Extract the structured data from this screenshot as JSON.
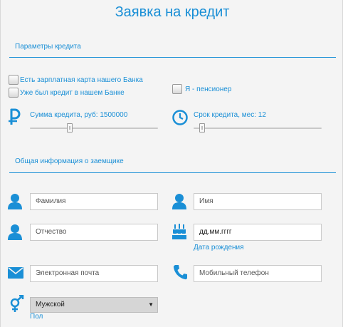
{
  "title": "Заявка на кредит",
  "credit_params": {
    "heading": "Параметры кредита",
    "checkboxes": [
      {
        "label": "Есть зарплатная карта нашего Банка",
        "checked": false
      },
      {
        "label": "Уже был кредит в нашем Банке",
        "checked": false
      },
      {
        "label": "Я - пенсионер",
        "checked": false
      }
    ],
    "amount_label": "Сумма кредита, руб: 1500000",
    "amount_value": 1500000,
    "term_label": "Срок кредита, мес: 12",
    "term_value": 12
  },
  "borrower": {
    "heading": "Общая информация о заемщике",
    "surname_placeholder": "Фамилия",
    "name_placeholder": "Имя",
    "patronymic_placeholder": "Отчество",
    "birthdate_value": "дд.мм.гггг",
    "birthdate_caption": "Дата рождения",
    "email_placeholder": "Электронная почта",
    "phone_placeholder": "Мобильный телефон",
    "gender_value": "Мужской",
    "gender_caption": "Пол"
  },
  "colors": {
    "accent": "#1a8fd6",
    "background": "#f4f4f4"
  }
}
